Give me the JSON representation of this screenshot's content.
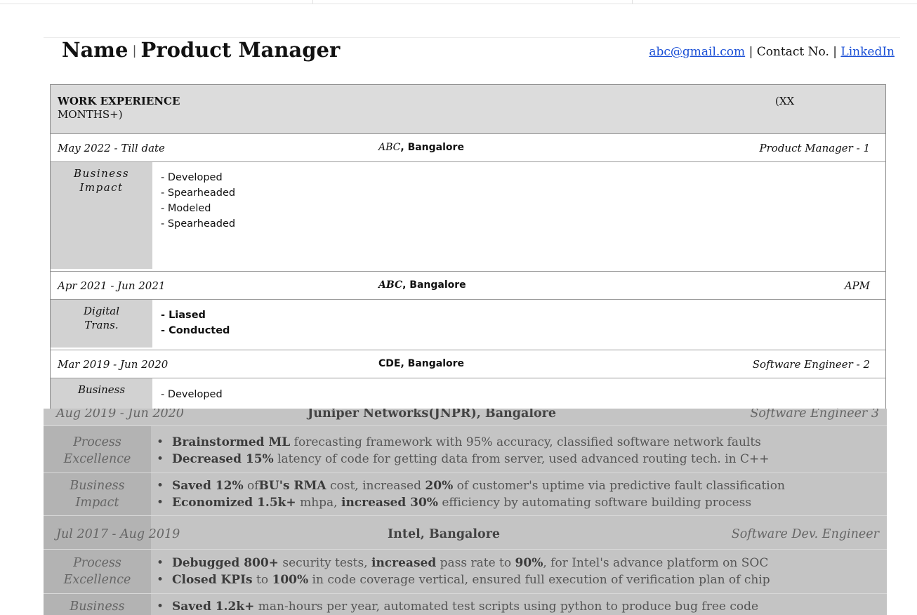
{
  "header": {
    "name": "Name",
    "separator": "|",
    "title": "Product Manager",
    "email": "abc@gmail.com",
    "sep1": " | ",
    "contact": "Contact No.",
    "sep2": " | ",
    "linkedin": "LinkedIn",
    "link_color": "#1a4fd6"
  },
  "section": {
    "title": "WORK EXPERIENCE",
    "continuation": "MONTHS+)",
    "duration": "(XX"
  },
  "jobs": [
    {
      "dates": "May 2022 - Till date",
      "company_name": "ABC",
      "company_loc": ", Bangalore",
      "role": "Product Manager - 1",
      "label_1": "Business",
      "label_2": "Impact",
      "bullets": [
        "- Developed",
        "- Spearheaded",
        "- Modeled",
        "- Spearheaded"
      ]
    },
    {
      "dates": "Apr 2021 - Jun 2021",
      "company_name": "ABC",
      "company_loc": ", Bangalore",
      "role": "APM",
      "label_1": "Digital",
      "label_2": "Trans.",
      "bullets": [
        "- Liased",
        "- Conducted"
      ]
    },
    {
      "dates": "Mar 2019 - Jun 2020",
      "company": "CDE,  Bangalore",
      "role": "Software Engineer - 2",
      "label_1": "Business",
      "bullets": [
        "- Developed"
      ]
    }
  ],
  "overlay": {
    "job1": {
      "dates": "Aug 2019 - Jun 2020",
      "company": "Juniper Networks(JNPR), Bangalore",
      "role": "Software Engineer 3"
    },
    "pe1": {
      "label_1": "Process",
      "label_2": "Excellence",
      "l1_bold": "Brainstormed ML",
      "l1_rest": " forecasting framework with 95% accuracy, classified software network faults",
      "l2_bold": "Decreased 15%",
      "l2_rest": " latency of code for getting data from server, used advanced routing tech. in C++"
    },
    "bi1": {
      "label_1": "Business",
      "label_2": "Impact",
      "l1_b1": "Saved 12%",
      "l1_t1": " of",
      "l1_b2": "BU's RMA",
      "l1_t2": " cost, increased ",
      "l1_b3": "20%",
      "l1_t3": " of customer's uptime via predictive fault classification",
      "l2_b1": "Economized 1.5k+",
      "l2_t1": " mhpa, ",
      "l2_b2": "increased 30%",
      "l2_t2": " efficiency by automating software building process"
    },
    "job2": {
      "dates": "Jul 2017 - Aug 2019",
      "company": "Intel, Bangalore",
      "role": "Software Dev. Engineer"
    },
    "pe2": {
      "label_1": "Process",
      "label_2": "Excellence",
      "l1_b1": "Debugged 800+",
      "l1_t1": " security tests, ",
      "l1_b2": "increased",
      "l1_t2": " pass rate to ",
      "l1_b3": "90%",
      "l1_t3": ", for Intel's advance platform on SOC",
      "l2_b1": "Closed KPIs",
      "l2_t1": " to ",
      "l2_b2": "100%",
      "l2_t2": " in code coverage vertical, ensured full execution of verification plan of chip"
    },
    "bi2": {
      "label_1": "Business",
      "l1_b1": "Saved 1.2k+",
      "l1_t1": " man-hours per year, automated test scripts using python to produce bug free code"
    },
    "bullet": "•"
  }
}
